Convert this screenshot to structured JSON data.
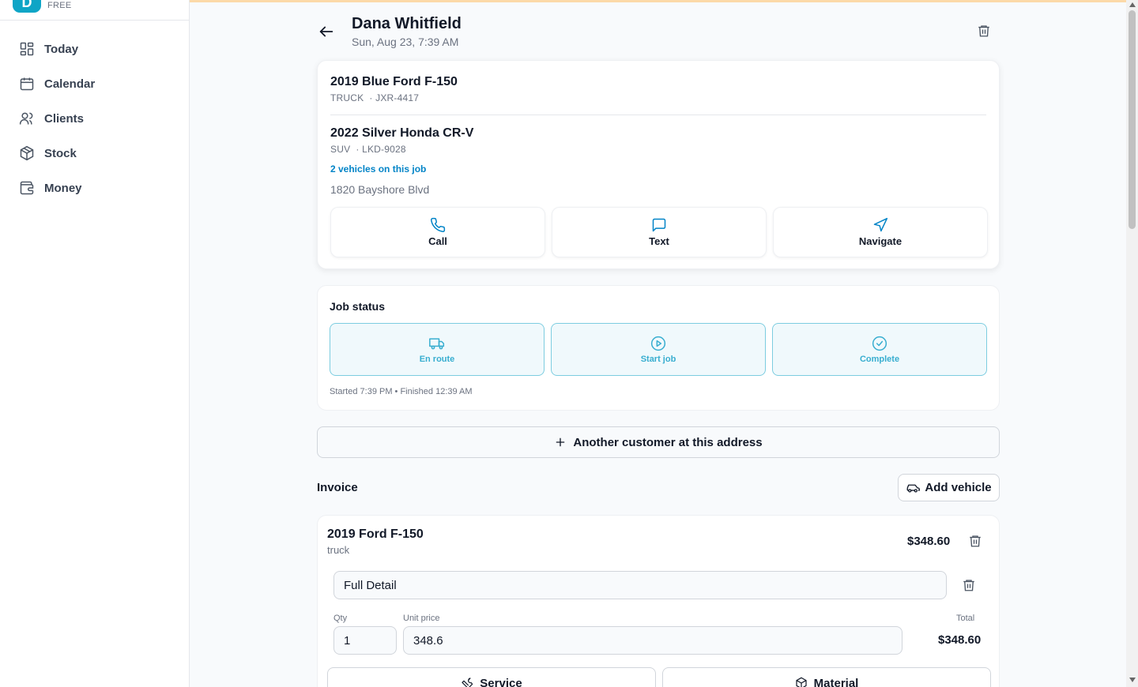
{
  "brand": {
    "logo_letter": "D",
    "plan": "FREE"
  },
  "nav": [
    {
      "label": "Today",
      "icon": "dashboard-icon"
    },
    {
      "label": "Calendar",
      "icon": "calendar-icon"
    },
    {
      "label": "Clients",
      "icon": "users-icon"
    },
    {
      "label": "Stock",
      "icon": "box-icon"
    },
    {
      "label": "Money",
      "icon": "wallet-icon"
    }
  ],
  "job": {
    "client_name": "Dana Whitfield",
    "date": "Sun, Aug 23, 7:39 AM",
    "vehicles": [
      {
        "title": "2019 Blue Ford F-150",
        "type": "TRUCK",
        "plate": "JXR-4417"
      },
      {
        "title": "2022 Silver Honda CR-V",
        "type": "SUV",
        "plate": "LKD-9028"
      }
    ],
    "vehicle_count": "2 vehicles on this job",
    "address": "1820 Bayshore Blvd",
    "actions": {
      "call": "Call",
      "text": "Text",
      "navigate": "Navigate"
    }
  },
  "status": {
    "title": "Job status",
    "buttons": {
      "en_route": "En route",
      "start": "Start job",
      "complete": "Complete"
    },
    "note": "Started 7:39 PM • Finished 12:39 AM"
  },
  "another_customer": "Another customer at this address",
  "invoice": {
    "title": "Invoice",
    "add_vehicle": "Add vehicle",
    "vehicle": {
      "title": "2019 Ford F-150",
      "type": "truck",
      "total": "$348.60",
      "line": {
        "name": "Full Detail",
        "qty_label": "Qty",
        "qty": "1",
        "price_label": "Unit price",
        "price": "348.6",
        "total_label": "Total",
        "total": "$348.60"
      },
      "add_service": "Service",
      "add_material": "Material"
    }
  },
  "colors": {
    "accent": "#0284c7",
    "status_border": "#7dcde0",
    "status_text": "#38aed0",
    "topbar": "#fcd9a8"
  }
}
